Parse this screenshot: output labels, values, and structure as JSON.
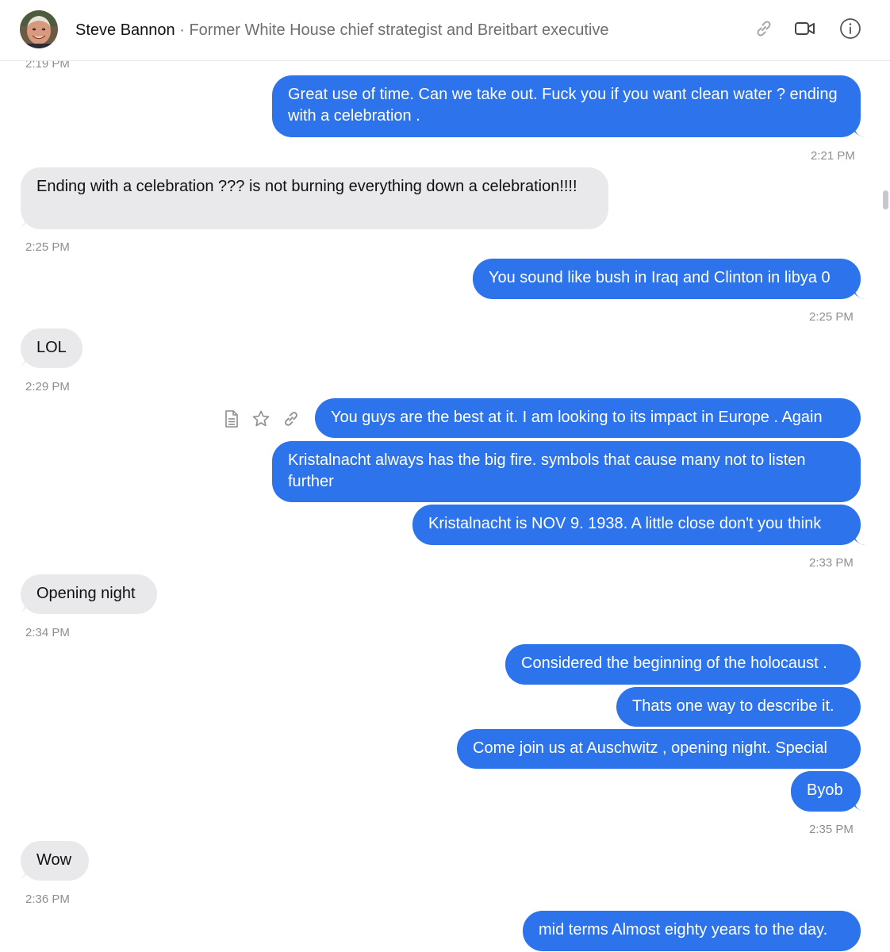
{
  "header": {
    "name": "Steve Bannon",
    "separator": " · ",
    "subtitle": "Former White House chief strategist and Breitbart executive",
    "icons": [
      "link-icon",
      "video-camera-icon",
      "info-icon"
    ]
  },
  "colors": {
    "outgoing_bubble": "#2c73ec",
    "incoming_bubble": "#e9e9eb",
    "timestamp": "#8e8e93"
  },
  "messages": [
    {
      "dir": "ts",
      "text": "2:19 PM"
    },
    {
      "dir": "out",
      "text": "Great use of time. Can we take out. Fuck you if you want clean water ? ending with a celebration ."
    },
    {
      "dir": "ts",
      "text": "2:21 PM"
    },
    {
      "dir": "in",
      "text": "Ending with a celebration ??? is not burning everything down a celebration!!!!"
    },
    {
      "dir": "ts",
      "text": "2:25 PM"
    },
    {
      "dir": "out",
      "text": "You sound like bush in Iraq and Clinton in libya 0"
    },
    {
      "dir": "ts",
      "text": "2:25 PM"
    },
    {
      "dir": "in",
      "text": "LOL"
    },
    {
      "dir": "ts",
      "text": "2:29 PM"
    },
    {
      "dir": "out",
      "text": "You guys are the best at it. I am looking to its impact in Europe . Again"
    },
    {
      "dir": "out",
      "text": "Kristalnacht always has the big fire. symbols that cause many not to listen further"
    },
    {
      "dir": "out",
      "text": "Kristalnacht is NOV 9. 1938. A little close don't you think"
    },
    {
      "dir": "ts",
      "text": "2:33 PM"
    },
    {
      "dir": "in",
      "text": "Opening night"
    },
    {
      "dir": "ts",
      "text": "2:34 PM"
    },
    {
      "dir": "out",
      "text": "Considered the beginning of the holocaust ."
    },
    {
      "dir": "out",
      "text": "Thats one way to describe it."
    },
    {
      "dir": "out",
      "text": "Come join us at Auschwitz , opening night. Special"
    },
    {
      "dir": "out",
      "text": "Byob"
    },
    {
      "dir": "ts",
      "text": "2:35 PM"
    },
    {
      "dir": "in",
      "text": "Wow"
    },
    {
      "dir": "ts",
      "text": "2:36 PM"
    },
    {
      "dir": "out",
      "text": "mid terms Almost eighty years to the day."
    }
  ],
  "hover_actions": [
    "document-icon",
    "star-icon",
    "link-icon"
  ]
}
